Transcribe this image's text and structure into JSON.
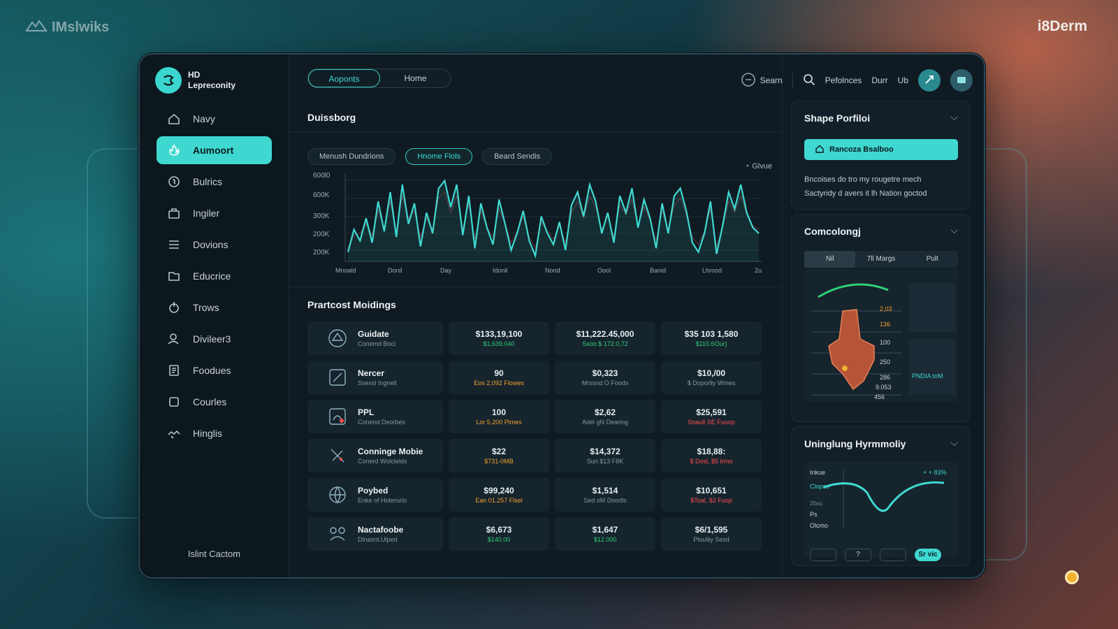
{
  "brand_left": "IMslwiks",
  "brand_right": "i8Derm",
  "app": {
    "name_line1": "HD",
    "name_line2": "Lepreconity"
  },
  "sidebar": {
    "items": [
      {
        "label": "Navy",
        "icon": "home-icon"
      },
      {
        "label": "Aumoort",
        "icon": "flame-icon",
        "active": true
      },
      {
        "label": "Bulrics",
        "icon": "coin-icon"
      },
      {
        "label": "Ingiler",
        "icon": "briefcase-icon"
      },
      {
        "label": "Dovions",
        "icon": "menu-lines-icon"
      },
      {
        "label": "Educrice",
        "icon": "folder-icon"
      },
      {
        "label": "Trows",
        "icon": "power-icon"
      },
      {
        "label": "Divileer3",
        "icon": "user-icon"
      },
      {
        "label": "Foodues",
        "icon": "document-icon"
      },
      {
        "label": "Courles",
        "icon": "square-icon"
      },
      {
        "label": "Hinglis",
        "icon": "handshake-icon"
      }
    ],
    "footer": "Islint Cactom"
  },
  "topbar": {
    "tabs": [
      "Aoponts",
      "Home"
    ],
    "search_label": "Searn",
    "links": [
      "Pefolnces",
      "Durr",
      "Ub"
    ]
  },
  "dashboard": {
    "title": "Duissborg",
    "pills": [
      "Menush Dundrions",
      "Hnome Flols",
      "Beard Sendis"
    ],
    "cursor_label": "Glvue"
  },
  "chart_data": {
    "type": "line",
    "ytick_labels": [
      "600K",
      "300K",
      "200K",
      "200K"
    ],
    "ytop_label": "600l0",
    "xtick_labels": [
      "Mnoald",
      "Donil",
      "Day",
      "Idonil",
      "Nond",
      "Oool",
      "Banid",
      "Lhrood",
      "2u"
    ],
    "series": [
      {
        "values": [
          200,
          320,
          260,
          380,
          250,
          470,
          310,
          520,
          280,
          560,
          350,
          460,
          230,
          410,
          300,
          540,
          580,
          440,
          560,
          290,
          500,
          220,
          460,
          330,
          240,
          480,
          350,
          210,
          300,
          420,
          260,
          180,
          390,
          300,
          240,
          360,
          210,
          450,
          520,
          390,
          560,
          470,
          300,
          410,
          250,
          500,
          410,
          540,
          330,
          480,
          380,
          220,
          460,
          300,
          500,
          540,
          420,
          250,
          200,
          300,
          470,
          190,
          340,
          520,
          430,
          560,
          410,
          330,
          300
        ]
      },
      {
        "values": [
          220,
          290,
          300,
          350,
          290,
          420,
          330,
          470,
          300,
          500,
          380,
          420,
          280,
          380,
          320,
          490,
          520,
          410,
          500,
          320,
          460,
          270,
          420,
          330,
          280,
          430,
          350,
          250,
          310,
          390,
          280,
          220,
          360,
          310,
          270,
          340,
          250,
          410,
          470,
          380,
          500,
          440,
          320,
          390,
          280,
          450,
          400,
          480,
          340,
          440,
          370,
          260,
          420,
          310,
          450,
          490,
          400,
          280,
          240,
          310,
          430,
          230,
          330,
          470,
          410,
          500,
          400,
          340,
          320
        ]
      }
    ]
  },
  "holdings": {
    "title": "Prartcost Moidings",
    "rows": [
      {
        "icon": "ship-icon",
        "name": "Guidate",
        "sub": "Conemd Bocl",
        "c1": {
          "main": "$133,19,100",
          "sub": "$1,639.040",
          "tone": "c-green"
        },
        "c2": {
          "main": "$11,222.45,000",
          "sub": "Sxoo $ 172.0,72",
          "tone": "c-green"
        },
        "c3": {
          "main": "$35 103 1,580",
          "sub": "$110.6Our)",
          "tone": "c-green"
        }
      },
      {
        "icon": "pen-icon",
        "name": "Nercer",
        "sub": "Ssessl Ingnell",
        "c1": {
          "main": "90",
          "sub": "Eos 2,092 Flowes",
          "tone": "c-orange"
        },
        "c2": {
          "main": "$0,323",
          "sub": "Mrssnd O Foods",
          "tone": "c-muted"
        },
        "c3": {
          "main": "$10,/00",
          "sub": "$ Doporlly Wmes",
          "tone": "c-muted"
        }
      },
      {
        "icon": "gauge-icon",
        "name": "PPL",
        "sub": "Conend Deorbes",
        "c1": {
          "main": "100",
          "sub": "Lor 5,200 Pimes",
          "tone": "c-orange"
        },
        "c2": {
          "main": "$2,62",
          "sub": "Adel gN Dearing",
          "tone": "c-muted"
        },
        "c3": {
          "main": "$25,591",
          "sub": "Snaull SE Fuuop",
          "tone": "c-red"
        }
      },
      {
        "icon": "tools-icon",
        "name": "Conninge Mobie",
        "sub": "Conerd Wolclelds",
        "c1": {
          "main": "$22",
          "sub": "$731-0MB",
          "tone": "c-orange"
        },
        "c2": {
          "main": "$14,372",
          "sub": "Sun $13 F8K",
          "tone": "c-muted"
        },
        "c3": {
          "main": "$18,88:",
          "sub": "$ Dosl, $5 Irmo",
          "tone": "c-red"
        }
      },
      {
        "icon": "globe-icon",
        "name": "Poybed",
        "sub": "Enke of Hoterurlo",
        "c1": {
          "main": "$99,240",
          "sub": "Ean 01.257 Flsel",
          "tone": "c-orange"
        },
        "c2": {
          "main": "$1,514",
          "sub": "Sed oM Doodls",
          "tone": "c-muted"
        },
        "c3": {
          "main": "$10,651",
          "sub": "$Toal, $2 Fuop",
          "tone": "c-red"
        }
      },
      {
        "icon": "network-icon",
        "name": "Nactafoobe",
        "sub": "Dlnasnt.Ulped",
        "c1": {
          "main": "$6,673",
          "sub": "$140.00",
          "tone": "c-green"
        },
        "c2": {
          "main": "$1,647",
          "sub": "$12.000",
          "tone": "c-green"
        },
        "c3": {
          "main": "$6/1,595",
          "sub": "Ploulliy Sesd",
          "tone": "c-muted"
        }
      }
    ]
  },
  "right": {
    "portfolio": {
      "title": "Shape Porfiloi",
      "cta": "Rancoza Bsalboo",
      "text1": "Bncoises do tro my rougetre mech",
      "text2": "Sactyridy d avers it lh Nation goctod"
    },
    "comcolongi": {
      "title": "Comcolongj",
      "tabs": [
        "Nil",
        "7ll Margs",
        "Pult"
      ],
      "labels": [
        "2,03",
        "136",
        "100",
        "250",
        "286",
        "9.053",
        "456"
      ],
      "side_label": "PNDIA toM"
    },
    "harmony": {
      "title": "Uninglung Hyrmmoliy",
      "labels": [
        "Inkue",
        "Clopes",
        "20ou",
        "Ps",
        "Olcmo"
      ],
      "value": "+ + 83%",
      "btn_mid": "?",
      "btn_save": "Sr vic"
    }
  }
}
